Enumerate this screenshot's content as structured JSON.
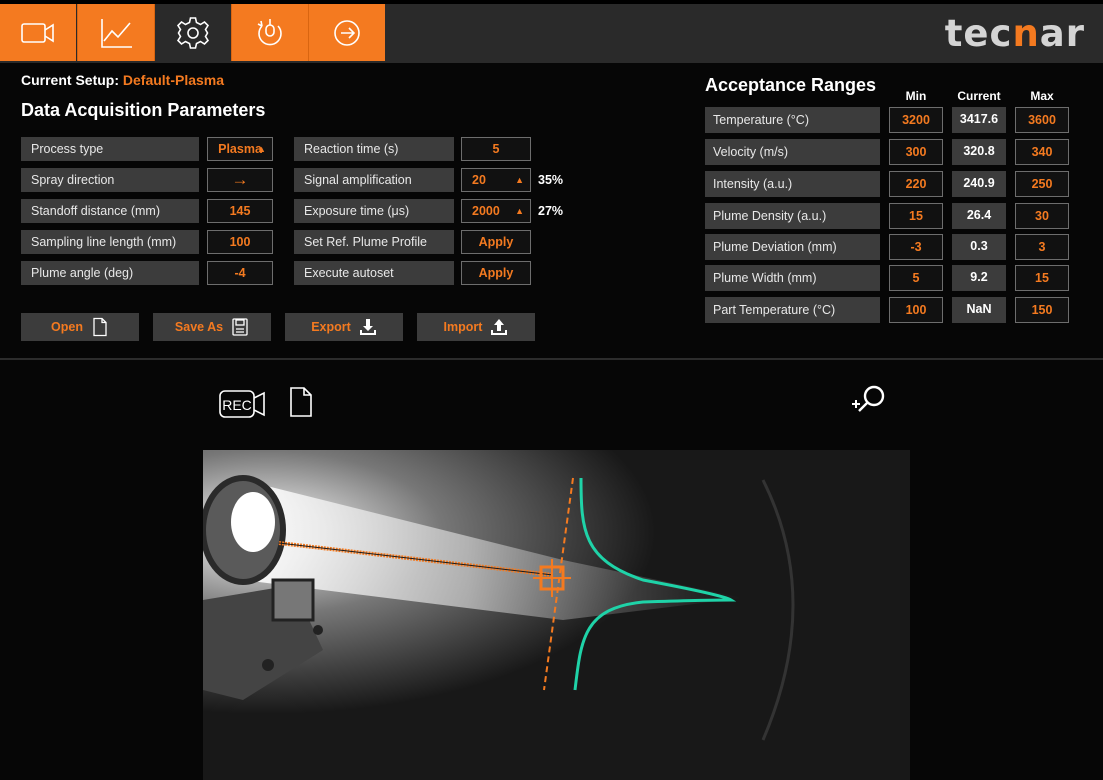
{
  "nav": {
    "tabs": [
      {
        "name": "camera-icon"
      },
      {
        "name": "chart-icon"
      },
      {
        "name": "settings-gear-icon"
      },
      {
        "name": "power-cycle-icon"
      },
      {
        "name": "logout-icon"
      }
    ],
    "active_index": 2
  },
  "brand": {
    "part1": "tec",
    "part2": "n",
    "part3": "ar"
  },
  "setup": {
    "label": "Current Setup: ",
    "value": "Default-Plasma"
  },
  "section_title": "Data Acquisition Parameters",
  "params_left": [
    {
      "label": "Process type",
      "value": "Plasma",
      "spinner": true
    },
    {
      "label": "Spray direction",
      "value": "→",
      "spinner": false
    },
    {
      "label": "Standoff distance (mm)",
      "value": "145",
      "spinner": false
    },
    {
      "label": "Sampling line length (mm)",
      "value": "100",
      "spinner": false
    },
    {
      "label": "Plume angle (deg)",
      "value": "-4",
      "spinner": false
    }
  ],
  "params_right": [
    {
      "label": "Reaction time (s)",
      "value": "5",
      "spinner": false,
      "pct": ""
    },
    {
      "label": "Signal amplification",
      "value": "20",
      "spinner": true,
      "pct": "35%"
    },
    {
      "label": "Exposure time (μs)",
      "value": "2000",
      "spinner": true,
      "pct": "27%"
    },
    {
      "label": "Set Ref. Plume Profile",
      "value": "Apply",
      "spinner": false,
      "pct": ""
    },
    {
      "label": "Execute autoset",
      "value": "Apply",
      "spinner": false,
      "pct": ""
    }
  ],
  "actions": [
    {
      "label": "Open",
      "icon": "file-icon"
    },
    {
      "label": "Save As",
      "icon": "save-icon"
    },
    {
      "label": "Export",
      "icon": "export-icon"
    },
    {
      "label": "Import",
      "icon": "import-icon"
    }
  ],
  "acceptance": {
    "title": "Acceptance Ranges",
    "headers": {
      "min": "Min",
      "current": "Current",
      "max": "Max"
    },
    "rows": [
      {
        "label": "Temperature (°C)",
        "min": "3200",
        "current": "3417.6",
        "max": "3600"
      },
      {
        "label": "Velocity (m/s)",
        "min": "300",
        "current": "320.8",
        "max": "340"
      },
      {
        "label": "Intensity (a.u.)",
        "min": "220",
        "current": "240.9",
        "max": "250"
      },
      {
        "label": "Plume Density (a.u.)",
        "min": "15",
        "current": "26.4",
        "max": "30"
      },
      {
        "label": "Plume Deviation (mm)",
        "min": "-3",
        "current": "0.3",
        "max": "3"
      },
      {
        "label": "Plume Width (mm)",
        "min": "5",
        "current": "9.2",
        "max": "15"
      },
      {
        "label": "Part Temperature (°C)",
        "min": "100",
        "current": "NaN",
        "max": "150"
      }
    ]
  },
  "viewer": {
    "rec_label": "REC"
  },
  "colors": {
    "accent": "#f47a20",
    "profile": "#1fd3a8",
    "panel": "#3c3c3c"
  }
}
